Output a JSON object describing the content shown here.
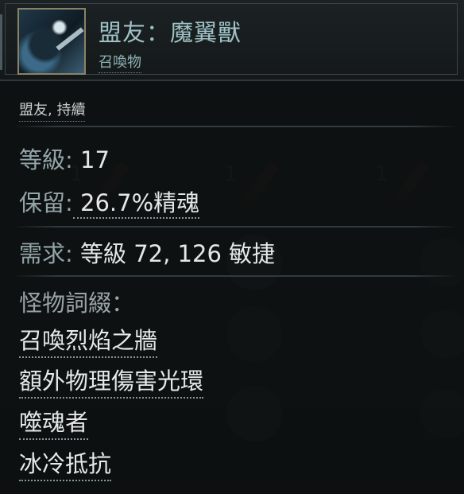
{
  "item": {
    "title": "盟友：魔翼獸",
    "subtitle": "召喚物",
    "tags": "盟友, 持續",
    "portrait_icon": "winged-beast-portrait"
  },
  "stats": {
    "level": {
      "label": "等級:",
      "value": " 17"
    },
    "reservation": {
      "label": "保留:",
      "value": " 26.7%精魂"
    },
    "requirements": {
      "label": "需求:",
      "value": " 等級 72, 126 敏捷"
    }
  },
  "modifiers": {
    "title": "怪物詞綴：",
    "items": [
      "召喚烈焰之牆",
      "額外物理傷害光環",
      "噬魂者",
      "冰冷抵抗"
    ]
  },
  "background": {
    "digits": [
      "1",
      "1",
      "1"
    ]
  },
  "colors": {
    "title": "#9fc2c6",
    "label": "#93a5a8",
    "value": "#e3e7e8"
  }
}
